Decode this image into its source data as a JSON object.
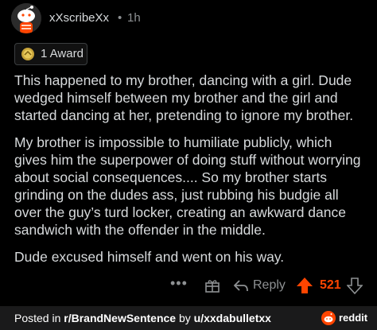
{
  "comment": {
    "username": "xXscribeXx",
    "separator": "•",
    "time": "1h",
    "award_label": "1 Award",
    "paragraphs": [
      "This happened to my brother, dancing with a girl. Dude wedged himself between my brother and the girl and started dancing at her, pretending to ignore my brother.",
      "My brother is impossible to humiliate publicly, which gives him the superpower of doing stuff without worrying about social consequences.... So my brother starts grinding on the dudes ass, just rubbing his budgie all over the guy’s turd locker, creating an awkward dance sandwich with the offender in the middle.",
      "Dude excused himself and went on his way."
    ]
  },
  "actions": {
    "more_label": "•••",
    "reply_label": "Reply",
    "score": "521"
  },
  "footer": {
    "prefix": "Posted in ",
    "subreddit": "r/BrandNewSentence",
    "middle": " by ",
    "user": "u/xxdabulletxx",
    "brand": "reddit"
  },
  "colors": {
    "background": "#000000",
    "text": "#d7dadc",
    "muted": "#8e9193",
    "upvote": "#ff4500"
  }
}
